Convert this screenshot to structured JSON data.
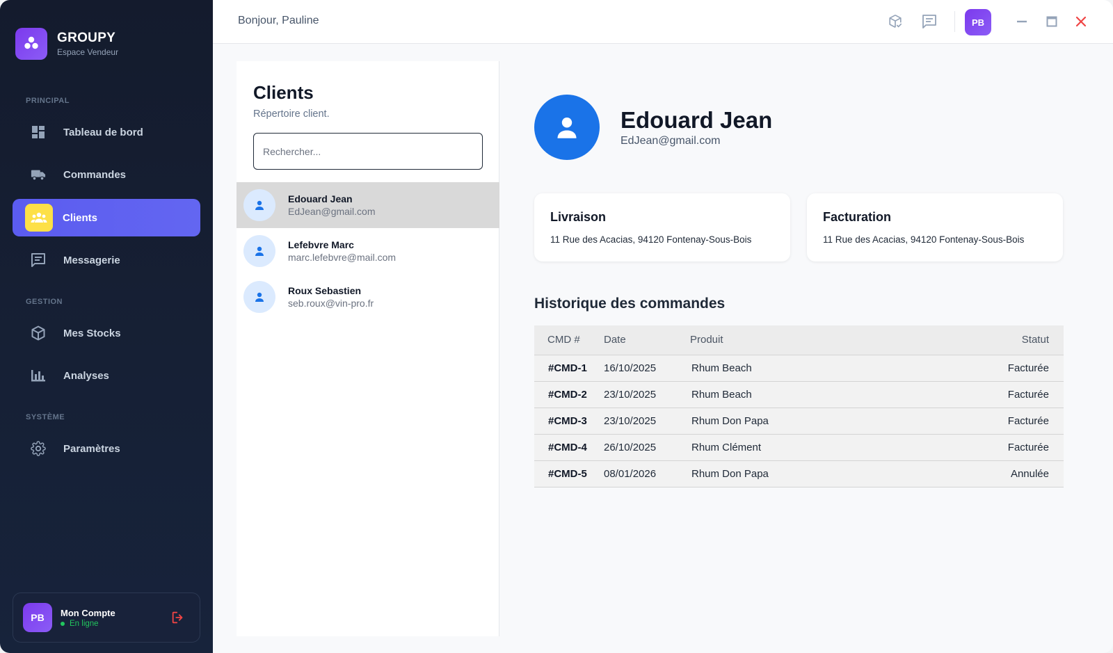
{
  "app": {
    "name": "GROUPY",
    "subtitle": "Espace Vendeur"
  },
  "sidebar": {
    "sections": [
      "PRINCIPAL",
      "GESTION",
      "SYSTÈME"
    ],
    "items": [
      {
        "label": "Tableau de bord",
        "icon": "dashboard-icon"
      },
      {
        "label": "Commandes",
        "icon": "truck-icon"
      },
      {
        "label": "Clients",
        "icon": "people-icon",
        "active": true
      },
      {
        "label": "Messagerie",
        "icon": "message-icon"
      },
      {
        "label": "Mes Stocks",
        "icon": "box-icon"
      },
      {
        "label": "Analyses",
        "icon": "bar-chart-icon"
      },
      {
        "label": "Paramètres",
        "icon": "gear-icon"
      }
    ],
    "account": {
      "initials": "PB",
      "name": "Mon Compte",
      "status": "En ligne"
    }
  },
  "topbar": {
    "greeting": "Bonjour, Pauline",
    "avatar_initials": "PB"
  },
  "clients": {
    "title": "Clients",
    "subtitle": "Répertoire client.",
    "search_placeholder": "Rechercher...",
    "list": [
      {
        "name": "Edouard Jean",
        "email": "EdJean@gmail.com",
        "selected": true
      },
      {
        "name": "Lefebvre Marc",
        "email": "marc.lefebvre@mail.com"
      },
      {
        "name": "Roux Sebastien",
        "email": "seb.roux@vin-pro.fr"
      }
    ]
  },
  "detail": {
    "name": "Edouard Jean",
    "email": "EdJean@gmail.com",
    "delivery": {
      "title": "Livraison",
      "address": "11 Rue des Acacias, 94120 Fontenay-Sous-Bois"
    },
    "billing": {
      "title": "Facturation",
      "address": "11 Rue des Acacias, 94120 Fontenay-Sous-Bois"
    },
    "history_title": "Historique des commandes",
    "columns": [
      "CMD #",
      "Date",
      "Produit",
      "Statut"
    ],
    "orders": [
      {
        "id": "#CMD-1",
        "date": "16/10/2025",
        "product": "Rhum Beach",
        "status": "Facturée"
      },
      {
        "id": "#CMD-2",
        "date": "23/10/2025",
        "product": "Rhum Beach",
        "status": "Facturée"
      },
      {
        "id": "#CMD-3",
        "date": "23/10/2025",
        "product": "Rhum Don Papa",
        "status": "Facturée"
      },
      {
        "id": "#CMD-4",
        "date": "26/10/2025",
        "product": "Rhum Clément",
        "status": "Facturée"
      },
      {
        "id": "#CMD-5",
        "date": "08/01/2026",
        "product": "Rhum Don Papa",
        "status": "Annulée"
      }
    ]
  },
  "colors": {
    "accent": "#6366f1",
    "sidebar_bg": "#141b2d",
    "brand": "#7c3aed",
    "close": "#ef4444",
    "online": "#22c55e",
    "avatar_blue": "#1a73e8"
  }
}
